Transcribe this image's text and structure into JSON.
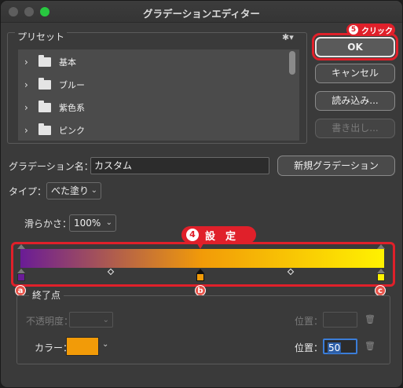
{
  "window": {
    "title": "グラデーションエディター"
  },
  "presets": {
    "label": "プリセット",
    "gear_icon": "gear-icon",
    "items": [
      {
        "label": "基本"
      },
      {
        "label": "ブルー"
      },
      {
        "label": "紫色系"
      },
      {
        "label": "ピンク"
      }
    ]
  },
  "buttons": {
    "ok": "OK",
    "cancel": "キャンセル",
    "load": "読み込み...",
    "save": "書き出し...",
    "new_gradient": "新規グラデーション"
  },
  "annotations": {
    "click_num": "5",
    "click_label": "クリック",
    "settei_num": "4",
    "settei_label": "設　定",
    "marker_a": "a",
    "marker_b": "b",
    "marker_c": "c"
  },
  "name_field": {
    "label": "グラデーション名：",
    "value": "カスタム"
  },
  "type_field": {
    "label": "タイプ：",
    "value": "べた塗り"
  },
  "smoothness": {
    "label": "滑らかさ：",
    "value": "100%"
  },
  "gradient": {
    "stops": [
      {
        "color": "#6a1c96"
      },
      {
        "color": "#f29b08"
      },
      {
        "color": "#fff200"
      }
    ]
  },
  "endpoint": {
    "label": "終了点",
    "opacity_label": "不透明度：",
    "opacity_location_label": "位置：",
    "color_label": "カラー：",
    "color_value": "#f29b08",
    "color_location_label": "位置：",
    "color_location_value": "50"
  },
  "colors": {
    "accent": "#e0202a",
    "ok_border": "#e8e8e8"
  }
}
